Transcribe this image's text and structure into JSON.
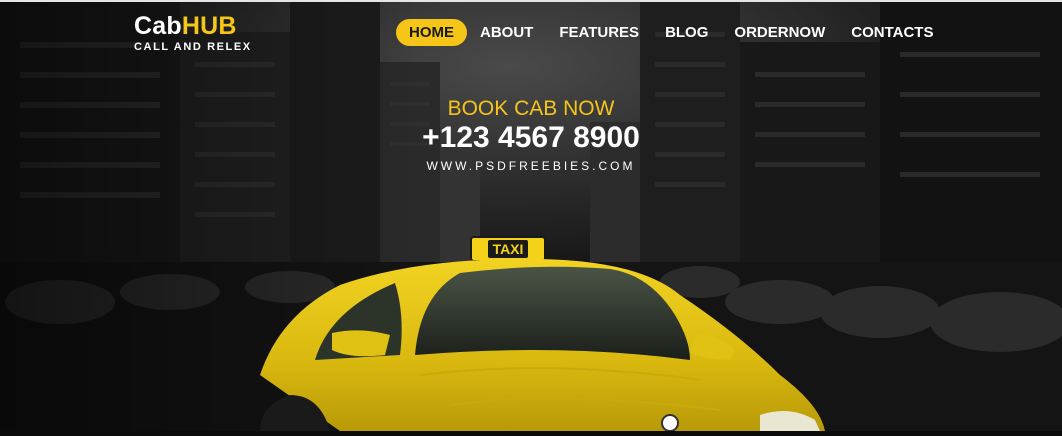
{
  "brand": {
    "name_part1": "Cab",
    "name_part2": "HUB",
    "tagline": "CALL AND RELEX"
  },
  "nav": {
    "items": [
      {
        "label": "HOME",
        "active": true
      },
      {
        "label": "ABOUT",
        "active": false
      },
      {
        "label": "FEATURES",
        "active": false
      },
      {
        "label": "BLOG",
        "active": false
      },
      {
        "label": "ORDERNOW",
        "active": false
      },
      {
        "label": "CONTACTS",
        "active": false
      }
    ]
  },
  "hero": {
    "cta_text": "BOOK CAB NOW",
    "phone": "+123 4567 8900",
    "website": "WWW.PSDFREEBIES.COM"
  },
  "taxi": {
    "sign_text": "TAXI"
  },
  "colors": {
    "accent": "#f5c518",
    "background": "#0b0b0b",
    "text": "#ffffff"
  }
}
